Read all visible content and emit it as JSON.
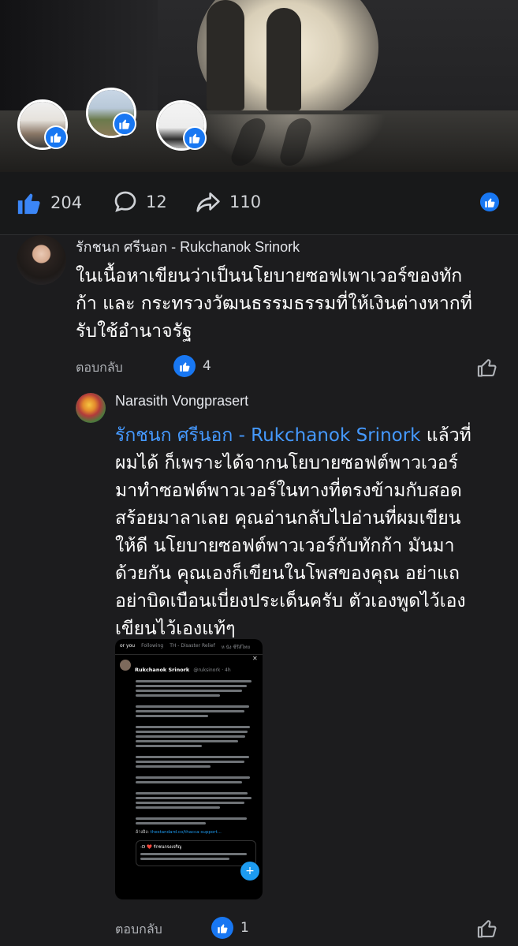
{
  "stats": {
    "likes": "204",
    "comments": "12",
    "shares": "110"
  },
  "comments": [
    {
      "author": "รักชนก ศรีนอก - Rukchanok Srinork",
      "text_lines": [
        "ในเนื้อหาเขียนว่าเป็นนโยบายซอฟเพาเวอร์ของทัก",
        "ก้า และ กระทรวงวัฒนธรรมธรรมที่ให้เงินต่างหากที่",
        "รับใช้อำนาจรัฐ"
      ],
      "reply_label": "ตอบกลับ",
      "reaction_count": "4"
    },
    {
      "author": "Narasith Vongprasert",
      "mention": "รักชนก ศรีนอก - Rukchanok Srinork",
      "text_first_rest": " แล้วที่",
      "text_lines": [
        "ผมได้ ก็เพราะได้จากนโยบายซอฟต์พาวเวอร์",
        "มาทำซอฟต์พาวเวอร์ในทางที่ตรงข้ามกับสอด",
        "สร้อยมาลาเลย คุณอ่านกลับไปอ่านที่ผมเขียน",
        "ให้ดี นโยบายซอฟต์พาวเวอร์กับทักก้า มันมา",
        "ด้วยกัน คุณเองก็เขียนในโพสของคุณ อย่าแถ",
        "อย่าบิดเบือนเบี่ยงประเด็นครับ ตัวเองพูดไว้เอง",
        "เขียนไว้เองแท้ๆ"
      ],
      "reply_label": "ตอบกลับ",
      "reaction_count": "1"
    }
  ],
  "embedded_screenshot": {
    "tabs": [
      "or you",
      "Following",
      "TH - Disaster Relief",
      "ห นัง ซีรีส์ไทย"
    ],
    "author": "Rukchanok Srinork",
    "handle": "@ruksinork · 4h",
    "link_prefix": "อ้างอิง:",
    "link_url": "thestandard.co/thacca-support...",
    "quote_author": "-D ❤️ รักชนกจงเจริญ"
  },
  "colors": {
    "background": "#1c1c1e",
    "accent_blue": "#1877f2",
    "mention_blue": "#4599ff"
  }
}
